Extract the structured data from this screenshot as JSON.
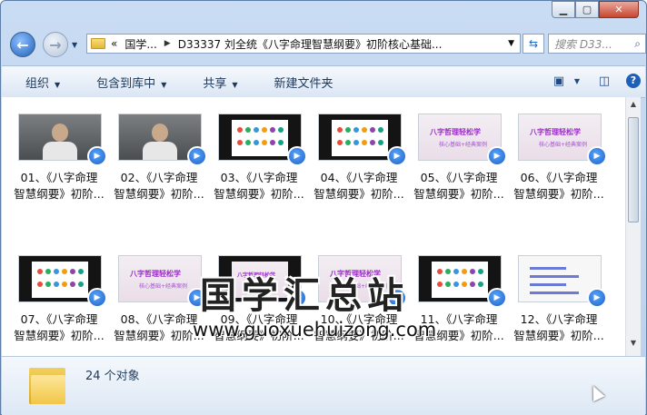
{
  "window": {
    "minimize_icon": "minimize-icon",
    "maximize_icon": "maximize-icon",
    "close_icon": "close-icon"
  },
  "nav": {
    "breadcrumb_prefix": "«",
    "breadcrumb_root": "国学...",
    "breadcrumb_current": "D33337 刘全统《八字命理智慧纲要》初阶核心基础...",
    "search_placeholder": "搜索 D33...",
    "refresh_icon": "refresh-icon"
  },
  "toolbar": {
    "organize": "组织",
    "include_library": "包含到库中",
    "share": "共享",
    "new_folder": "新建文件夹"
  },
  "files": [
    {
      "line1": "01、《八字命理",
      "line2": "智慧纲要》初阶...",
      "thumb": "person"
    },
    {
      "line1": "02、《八字命理",
      "line2": "智慧纲要》初阶...",
      "thumb": "person"
    },
    {
      "line1": "03、《八字命理",
      "line2": "智慧纲要》初阶...",
      "thumb": "dark"
    },
    {
      "line1": "04、《八字命理",
      "line2": "智慧纲要》初阶...",
      "thumb": "dark"
    },
    {
      "line1": "05、《八字命理",
      "line2": "智慧纲要》初阶...",
      "thumb": "pink"
    },
    {
      "line1": "06、《八字命理",
      "line2": "智慧纲要》初阶...",
      "thumb": "pink"
    },
    {
      "line1": "07、《八字命理",
      "line2": "智慧纲要》初阶...",
      "thumb": "dark"
    },
    {
      "line1": "08、《八字命理",
      "line2": "智慧纲要》初阶...",
      "thumb": "pink"
    },
    {
      "line1": "09、《八字命理",
      "line2": "智慧纲要》初阶...",
      "thumb": "darkpink"
    },
    {
      "line1": "10、《八字命理",
      "line2": "智慧纲要》初阶...",
      "thumb": "pink"
    },
    {
      "line1": "11、《八字命理",
      "line2": "智慧纲要》初阶...",
      "thumb": "dark"
    },
    {
      "line1": "12、《八字命理",
      "line2": "智慧纲要》初阶...",
      "thumb": "white"
    }
  ],
  "thumb_text": {
    "title": "八字哲理轻松学",
    "subtitle": "核心基础+经典案例"
  },
  "status": {
    "count": "24 个对象"
  },
  "watermark": {
    "title": "国学汇总站",
    "url": "www.guoxuehuizong.com"
  }
}
